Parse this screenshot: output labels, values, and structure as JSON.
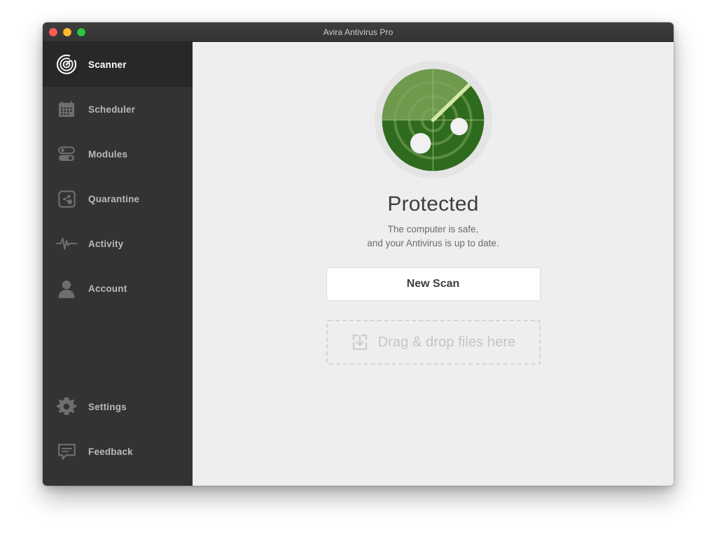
{
  "window": {
    "title": "Avira Antivirus Pro",
    "traffic_lights": [
      {
        "name": "close",
        "color": "#ff5f57"
      },
      {
        "name": "minimize",
        "color": "#febc2e"
      },
      {
        "name": "zoom",
        "color": "#29c840"
      }
    ]
  },
  "sidebar": {
    "top_items": [
      {
        "label": "Scanner",
        "icon": "radar-icon",
        "active": true
      },
      {
        "label": "Scheduler",
        "icon": "calendar-icon",
        "active": false
      },
      {
        "label": "Modules",
        "icon": "toggles-icon",
        "active": false
      },
      {
        "label": "Quarantine",
        "icon": "quarantine-icon",
        "active": false
      },
      {
        "label": "Activity",
        "icon": "waveform-icon",
        "active": false
      },
      {
        "label": "Account",
        "icon": "person-icon",
        "active": false
      }
    ],
    "bottom_items": [
      {
        "label": "Settings",
        "icon": "gear-icon",
        "active": false
      },
      {
        "label": "Feedback",
        "icon": "comment-icon",
        "active": false
      }
    ]
  },
  "main": {
    "status_icon": "radar-protected-icon",
    "status_title": "Protected",
    "status_line1": "The computer is safe,",
    "status_line2": "and your Antivirus is up to date.",
    "scan_button_label": "New Scan",
    "dropzone_icon": "download-tray-icon",
    "dropzone_label": "Drag & drop files here"
  },
  "colors": {
    "sidebar_bg": "#333333",
    "sidebar_active_bg": "#282828",
    "titlebar_bg": "#3a3a3a",
    "main_bg": "#eeeeee",
    "radar_light_green": "#6f9a4e",
    "radar_dark_green": "#2f6b1e",
    "radar_sweep": "#cfe39a",
    "accent_text": "#3d3d3d"
  }
}
